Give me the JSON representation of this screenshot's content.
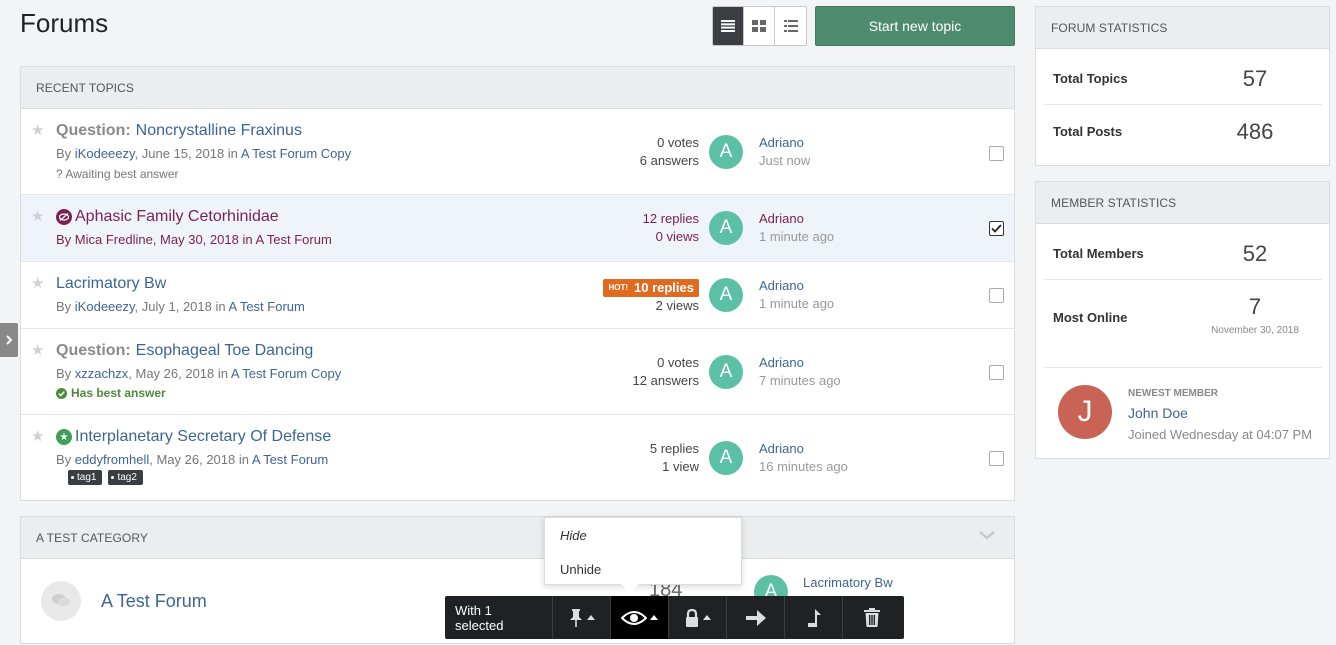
{
  "page": {
    "title": "Forums"
  },
  "toolbar": {
    "start_topic_label": "Start new topic"
  },
  "recent": {
    "header": "Recent Topics",
    "topics": [
      {
        "prefix": "Question:",
        "title": "Noncrystalline Fraxinus",
        "by": "By ",
        "author": "iKodeeezy",
        "date": ", June 15, 2018 in ",
        "forum": "A Test Forum Copy",
        "extra": "? Awaiting best answer",
        "stat1": "0 votes",
        "stat2": "6 answers",
        "avatar_letter": "A",
        "last_user": "Adriano",
        "last_time": "Just now"
      },
      {
        "prefix": "",
        "title": "Aphasic Family Cetorhinidae",
        "by": "By ",
        "author": "Mica Fredline",
        "date": ", May 30, 2018 in ",
        "forum": "A Test Forum",
        "stat1": "12 replies",
        "stat2": "0 views",
        "avatar_letter": "A",
        "last_user": "Adriano",
        "last_time": "1 minute ago"
      },
      {
        "prefix": "",
        "title": "Lacrimatory Bw",
        "by": "By ",
        "author": "iKodeeezy",
        "date": ", July 1, 2018 in ",
        "forum": "A Test Forum",
        "hot_label": "HOT!",
        "stat1": "10 replies",
        "stat2": "2 views",
        "avatar_letter": "A",
        "last_user": "Adriano",
        "last_time": "1 minute ago"
      },
      {
        "prefix": "Question:",
        "title": "Esophageal Toe Dancing",
        "by": "By ",
        "author": "xzzachzx",
        "date": ", May 26, 2018 in ",
        "forum": "A Test Forum Copy",
        "best": "Has best answer",
        "stat1": "0 votes",
        "stat2": "12 answers",
        "avatar_letter": "A",
        "last_user": "Adriano",
        "last_time": "7 minutes ago"
      },
      {
        "prefix": "",
        "title": "Interplanetary Secretary Of Defense",
        "by": "By ",
        "author": "eddyfromhell",
        "date": ", May 26, 2018 in ",
        "forum": "A Test Forum",
        "tags": [
          "tag1",
          "tag2"
        ],
        "stat1": "5 replies",
        "stat2": "1 view",
        "avatar_letter": "A",
        "last_user": "Adriano",
        "last_time": "16 minutes ago"
      }
    ]
  },
  "category": {
    "header": "A Test Category",
    "forum_name": "A Test Forum",
    "count": "184",
    "avatar_letter": "A",
    "last_topic": "Lacrimatory Bw"
  },
  "forum_stats": {
    "header": "Forum Statistics",
    "total_topics_label": "Total Topics",
    "total_topics": "57",
    "total_posts_label": "Total Posts",
    "total_posts": "486"
  },
  "member_stats": {
    "header": "Member Statistics",
    "total_members_label": "Total Members",
    "total_members": "52",
    "most_online_label": "Most Online",
    "most_online": "7",
    "most_online_date": "November 30, 2018",
    "newest_label": "Newest Member",
    "newest_name": "John Doe",
    "newest_letter": "J",
    "newest_joined": "Joined Wednesday at 04:07 PM"
  },
  "popup": {
    "hide": "Hide",
    "unhide": "Unhide"
  },
  "modbar": {
    "selected_text": "With 1 selected"
  },
  "icons": [
    "list-view-icon",
    "grid-view-icon",
    "fluid-view-icon",
    "star-icon",
    "eye-slash-icon",
    "check-circle-icon",
    "star-circle-icon",
    "chevron-down-icon",
    "comments-icon",
    "chevron-right-icon",
    "thumbtack-icon",
    "eye-icon",
    "lock-icon",
    "arrow-right-icon",
    "merge-icon",
    "trash-icon"
  ]
}
